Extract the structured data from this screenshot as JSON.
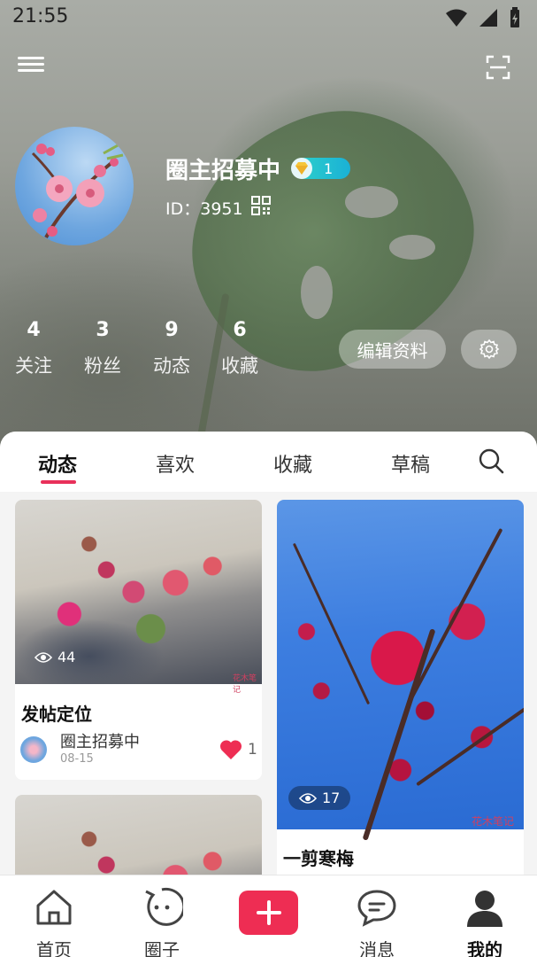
{
  "status_bar": {
    "time": "21:55"
  },
  "profile": {
    "name": "圈主招募中",
    "level": "1",
    "id_text": "ID：3951"
  },
  "stats": [
    {
      "value": "4",
      "label": "关注"
    },
    {
      "value": "3",
      "label": "粉丝"
    },
    {
      "value": "9",
      "label": "动态"
    },
    {
      "value": "6",
      "label": "收藏"
    }
  ],
  "actions": {
    "edit_profile": "编辑资料"
  },
  "tabs": [
    "动态",
    "喜欢",
    "收藏",
    "草稿"
  ],
  "posts": [
    {
      "title": "发帖定位",
      "views": "44",
      "author": "圈主招募中",
      "date": "08-15",
      "likes": "1",
      "watermark": "花木笔记"
    },
    {
      "title": "一剪寒梅",
      "views": "17",
      "watermark": "花木笔记"
    },
    {
      "title": "",
      "views": ""
    }
  ],
  "bottom_nav": {
    "home": "首页",
    "circle": "圈子",
    "messages": "消息",
    "me": "我的"
  },
  "colors": {
    "accent": "#ee2d53",
    "tab_underline": "#e8305a",
    "level_badge": "#1ab1d6"
  }
}
